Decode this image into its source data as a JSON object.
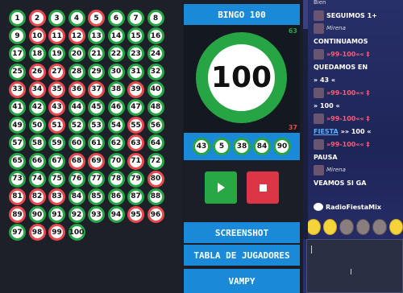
{
  "board": {
    "balls": [
      {
        "n": "1",
        "c": "g"
      },
      {
        "n": "2",
        "c": "r"
      },
      {
        "n": "3",
        "c": "g"
      },
      {
        "n": "4",
        "c": "g"
      },
      {
        "n": "5",
        "c": "r"
      },
      {
        "n": "6",
        "c": "g"
      },
      {
        "n": "7",
        "c": "g"
      },
      {
        "n": "8",
        "c": "g"
      },
      {
        "n": "9",
        "c": "g"
      },
      {
        "n": "10",
        "c": "r"
      },
      {
        "n": "11",
        "c": "r"
      },
      {
        "n": "12",
        "c": "r"
      },
      {
        "n": "13",
        "c": "g"
      },
      {
        "n": "14",
        "c": "g"
      },
      {
        "n": "15",
        "c": "g"
      },
      {
        "n": "16",
        "c": "g"
      },
      {
        "n": "17",
        "c": "g"
      },
      {
        "n": "18",
        "c": "g"
      },
      {
        "n": "19",
        "c": "g"
      },
      {
        "n": "20",
        "c": "g"
      },
      {
        "n": "21",
        "c": "g"
      },
      {
        "n": "22",
        "c": "g"
      },
      {
        "n": "23",
        "c": "g"
      },
      {
        "n": "24",
        "c": "g"
      },
      {
        "n": "25",
        "c": "g"
      },
      {
        "n": "26",
        "c": "r"
      },
      {
        "n": "27",
        "c": "r"
      },
      {
        "n": "28",
        "c": "g"
      },
      {
        "n": "29",
        "c": "g"
      },
      {
        "n": "30",
        "c": "g"
      },
      {
        "n": "31",
        "c": "g"
      },
      {
        "n": "32",
        "c": "g"
      },
      {
        "n": "33",
        "c": "r"
      },
      {
        "n": "34",
        "c": "r"
      },
      {
        "n": "35",
        "c": "r"
      },
      {
        "n": "36",
        "c": "r"
      },
      {
        "n": "37",
        "c": "r"
      },
      {
        "n": "38",
        "c": "g"
      },
      {
        "n": "39",
        "c": "r"
      },
      {
        "n": "40",
        "c": "g"
      },
      {
        "n": "41",
        "c": "g"
      },
      {
        "n": "42",
        "c": "g"
      },
      {
        "n": "43",
        "c": "r"
      },
      {
        "n": "44",
        "c": "g"
      },
      {
        "n": "45",
        "c": "g"
      },
      {
        "n": "46",
        "c": "g"
      },
      {
        "n": "47",
        "c": "g"
      },
      {
        "n": "48",
        "c": "g"
      },
      {
        "n": "49",
        "c": "g"
      },
      {
        "n": "50",
        "c": "g"
      },
      {
        "n": "51",
        "c": "r"
      },
      {
        "n": "52",
        "c": "g"
      },
      {
        "n": "53",
        "c": "g"
      },
      {
        "n": "54",
        "c": "g"
      },
      {
        "n": "55",
        "c": "r"
      },
      {
        "n": "56",
        "c": "g"
      },
      {
        "n": "57",
        "c": "g"
      },
      {
        "n": "58",
        "c": "g"
      },
      {
        "n": "59",
        "c": "g"
      },
      {
        "n": "60",
        "c": "g"
      },
      {
        "n": "61",
        "c": "g"
      },
      {
        "n": "62",
        "c": "g"
      },
      {
        "n": "63",
        "c": "r"
      },
      {
        "n": "64",
        "c": "g"
      },
      {
        "n": "65",
        "c": "g"
      },
      {
        "n": "66",
        "c": "g"
      },
      {
        "n": "67",
        "c": "g"
      },
      {
        "n": "68",
        "c": "r"
      },
      {
        "n": "69",
        "c": "r"
      },
      {
        "n": "70",
        "c": "g"
      },
      {
        "n": "71",
        "c": "r"
      },
      {
        "n": "72",
        "c": "g"
      },
      {
        "n": "73",
        "c": "g"
      },
      {
        "n": "74",
        "c": "g"
      },
      {
        "n": "75",
        "c": "g"
      },
      {
        "n": "76",
        "c": "g"
      },
      {
        "n": "77",
        "c": "g"
      },
      {
        "n": "78",
        "c": "g"
      },
      {
        "n": "79",
        "c": "g"
      },
      {
        "n": "80",
        "c": "r"
      },
      {
        "n": "81",
        "c": "r"
      },
      {
        "n": "82",
        "c": "r"
      },
      {
        "n": "83",
        "c": "r"
      },
      {
        "n": "84",
        "c": "g"
      },
      {
        "n": "85",
        "c": "g"
      },
      {
        "n": "86",
        "c": "g"
      },
      {
        "n": "87",
        "c": "g"
      },
      {
        "n": "88",
        "c": "g"
      },
      {
        "n": "89",
        "c": "r"
      },
      {
        "n": "90",
        "c": "g"
      },
      {
        "n": "91",
        "c": "g"
      },
      {
        "n": "92",
        "c": "g"
      },
      {
        "n": "93",
        "c": "g"
      },
      {
        "n": "94",
        "c": "g"
      },
      {
        "n": "95",
        "c": "r"
      },
      {
        "n": "96",
        "c": "r"
      },
      {
        "n": "97",
        "c": "g"
      },
      {
        "n": "98",
        "c": "r"
      },
      {
        "n": "99",
        "c": "r"
      },
      {
        "n": "100",
        "c": "g"
      }
    ],
    "colors": {
      "green": "#27a545",
      "red": "#e8494c"
    }
  },
  "game": {
    "title": "BINGO 100",
    "current_ball": "100",
    "drawn_count": "63",
    "remaining_count": "37",
    "recent_balls": [
      "43",
      "5",
      "38",
      "84",
      "90"
    ],
    "play_icon": "play-icon",
    "stop_icon": "stop-icon"
  },
  "buttons": {
    "screenshot": "SCREENSHOT",
    "players_table": "TABLA DE JUGADORES",
    "vampy": "VAMPY"
  },
  "chat": {
    "messages": [
      {
        "text": "Bien",
        "style": "small",
        "avatar": false
      },
      {
        "text": "SEGUIMOS 1+",
        "style": "normal",
        "avatar": true
      },
      {
        "text": "Mirena",
        "style": "italic",
        "avatar": true
      },
      {
        "text": "CONTINUAMOS",
        "style": "normal",
        "avatar": false
      },
      {
        "text": "»99-100«« ‡",
        "style": "pink",
        "avatar": true
      },
      {
        "text": "QUEDAMOS EN",
        "style": "normal",
        "avatar": false
      },
      {
        "text": "» 43 «",
        "style": "normal",
        "avatar": false
      },
      {
        "text": "»99-100«« ‡",
        "style": "pink",
        "avatar": true
      },
      {
        "text": "» 100 «",
        "style": "normal",
        "avatar": false
      },
      {
        "text": "»99-100«« ‡",
        "style": "pink",
        "avatar": true
      },
      {
        "text": "»» 100 «",
        "style": "normal",
        "avatar": false,
        "link": "FIESTA"
      },
      {
        "text": "»99-100«« ‡",
        "style": "pink",
        "avatar": true
      },
      {
        "text": "PAUSA",
        "style": "normal",
        "avatar": false
      },
      {
        "text": "Mirena",
        "style": "italic",
        "avatar": true
      },
      {
        "text": "VEAMOS SI GA",
        "style": "normal",
        "avatar": false
      }
    ],
    "channel": "RadioFiestaMix",
    "emotes": [
      "emote-smile-icon",
      "emote-cool-icon",
      "emote-grin-icon",
      "emote-cat-icon",
      "emote-dog-icon",
      "emote-face-icon"
    ]
  }
}
